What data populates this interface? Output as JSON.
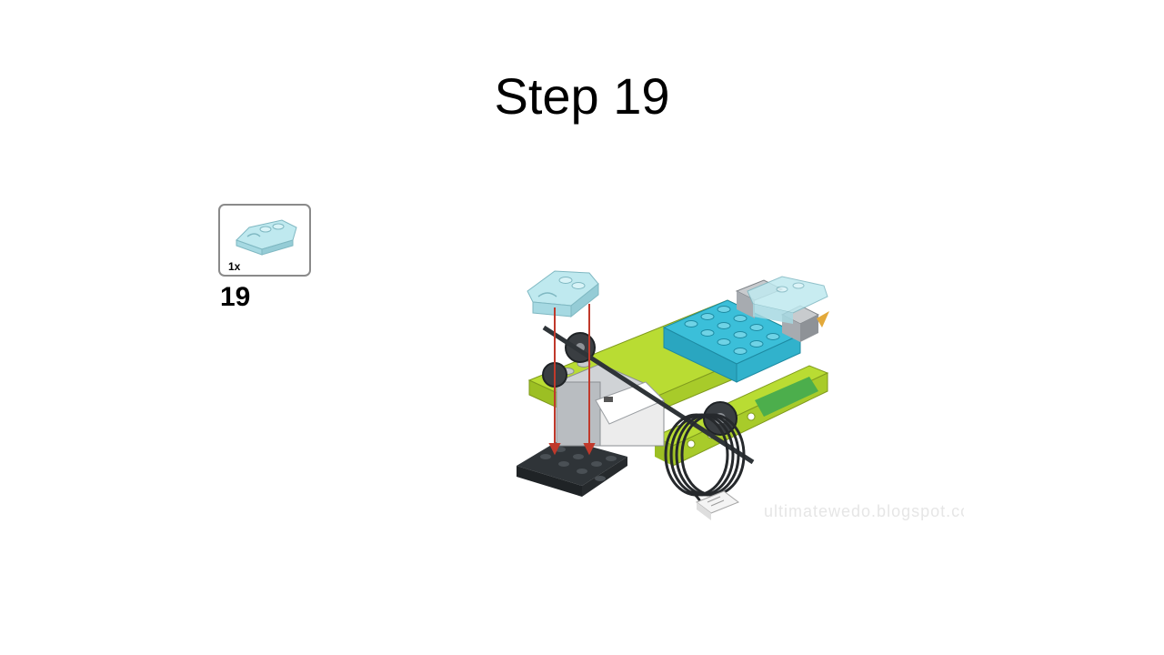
{
  "title": "Step 19",
  "parts_callout": {
    "quantity": "1x",
    "part_icon": "transparent-light-blue-curved-slope-brick"
  },
  "step_number": "19",
  "model_image": {
    "icon": "lego-wedo-model-assembly",
    "arrows_color": "#c0392b",
    "watermark": "ultimatewedo.blogspot.com"
  },
  "colors": {
    "lime": "#b9dc33",
    "azure": "#3bbfd9",
    "trans_light_blue": "#bfe9ef",
    "dark_gray": "#2f3438",
    "light_gray": "#a7abb0",
    "green": "#4cae4c"
  }
}
